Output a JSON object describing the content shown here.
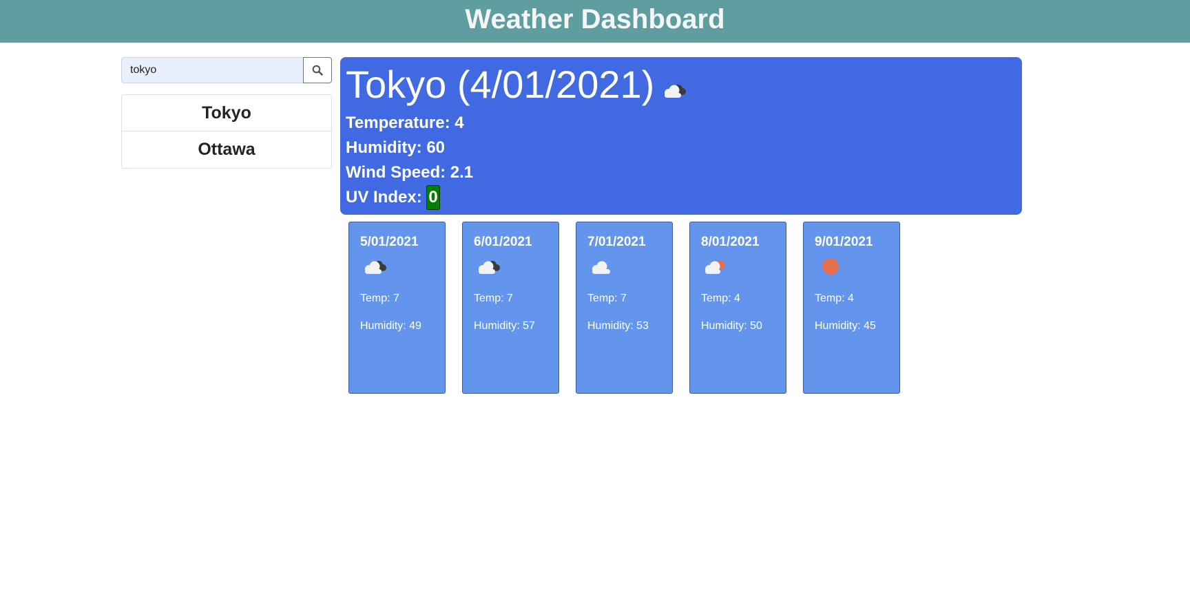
{
  "header": {
    "title": "Weather Dashboard"
  },
  "search": {
    "value": "tokyo",
    "button_icon": "search-icon"
  },
  "history": [
    {
      "label": "Tokyo"
    },
    {
      "label": "Ottawa"
    }
  ],
  "current": {
    "title": "Tokyo (4/01/2021)",
    "icon": "cloud-dark-icon",
    "temperature_label": "Temperature: 4",
    "humidity_label": "Humidity: 60",
    "wind_label": "Wind Speed: 2.1",
    "uv_label": "UV Index:",
    "uv_value": "0",
    "uv_color": "#008000"
  },
  "forecast": [
    {
      "date": "5/01/2021",
      "icon": "cloud-dark-icon",
      "temp": "Temp: 7",
      "humidity": "Humidity: 49"
    },
    {
      "date": "6/01/2021",
      "icon": "cloud-dark-icon",
      "temp": "Temp: 7",
      "humidity": "Humidity: 57"
    },
    {
      "date": "7/01/2021",
      "icon": "cloud-icon",
      "temp": "Temp: 7",
      "humidity": "Humidity: 53"
    },
    {
      "date": "8/01/2021",
      "icon": "cloud-sun-icon",
      "temp": "Temp: 4",
      "humidity": "Humidity: 50"
    },
    {
      "date": "9/01/2021",
      "icon": "sun-icon",
      "temp": "Temp: 4",
      "humidity": "Humidity: 45"
    }
  ],
  "colors": {
    "header_bg": "#5f9ea0",
    "current_bg": "#4169e1",
    "forecast_bg": "#6495ed",
    "sun": "#e8704f"
  }
}
